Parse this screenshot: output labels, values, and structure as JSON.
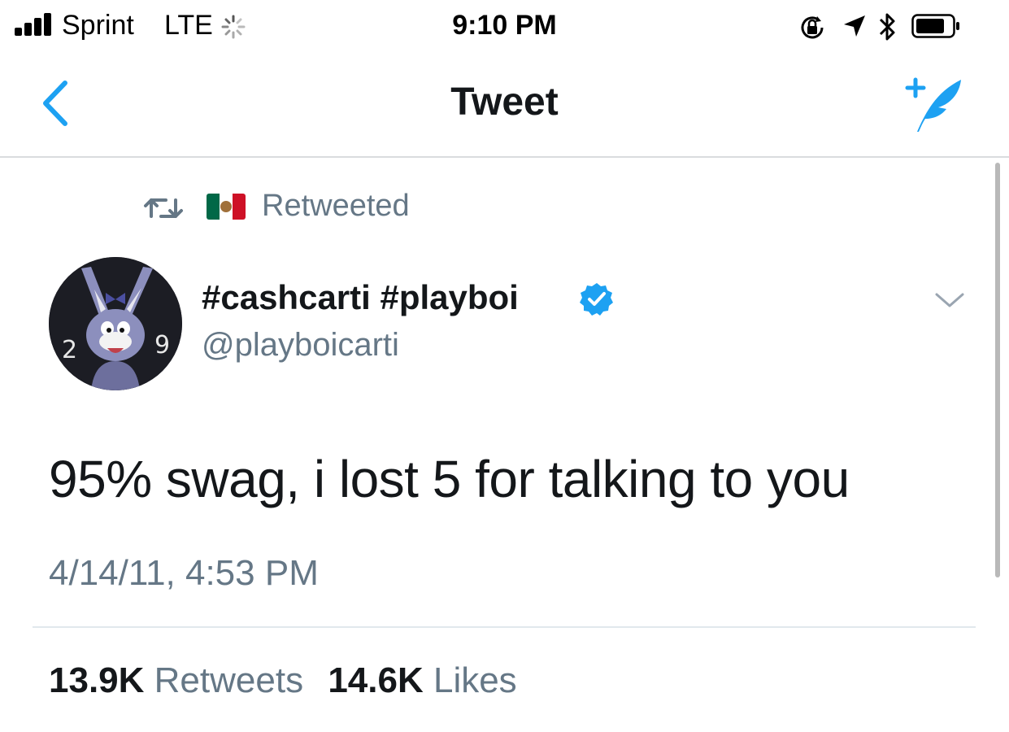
{
  "status_bar": {
    "carrier": "Sprint",
    "network": "LTE",
    "time": "9:10 PM",
    "icons": [
      "signal-bars-icon",
      "activity-spinner-icon",
      "orientation-lock-icon",
      "location-arrow-icon",
      "bluetooth-icon",
      "battery-icon"
    ]
  },
  "nav": {
    "title": "Tweet",
    "back_icon": "chevron-left-icon",
    "compose_icon": "compose-tweet-icon",
    "accent_color": "#1da1f2"
  },
  "tweet": {
    "retweet_label": "Retweeted",
    "retweeter_flag": "mexico-flag-icon",
    "author": {
      "display_name": "#cashcarti #playboi",
      "handle": "@playboicarti",
      "verified": true
    },
    "text": "95% swag, i lost 5 for talking to you",
    "timestamp": "4/14/11, 4:53 PM",
    "stats": {
      "retweets_count": "13.9K",
      "retweets_label": "Retweets",
      "likes_count": "14.6K",
      "likes_label": "Likes"
    }
  },
  "colors": {
    "primary_text": "#14171a",
    "secondary_text": "#657786",
    "accent": "#1da1f2",
    "divider": "#e1e8ed"
  }
}
